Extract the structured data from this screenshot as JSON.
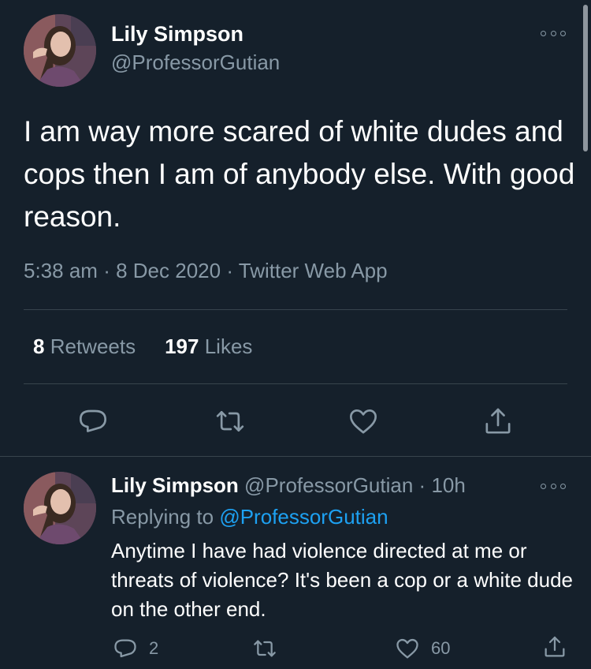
{
  "tweet": {
    "author_name": "Lily Simpson",
    "author_handle": "@ProfessorGutian",
    "text": "I am way more scared of white dudes and cops then I am of anybody else. With good reason.",
    "time": "5:38 am",
    "date": "8 Dec 2020",
    "source": "Twitter Web App",
    "retweets_count": "8",
    "retweets_label": "Retweets",
    "likes_count": "197",
    "likes_label": "Likes"
  },
  "reply": {
    "author_name": "Lily Simpson",
    "author_handle": "@ProfessorGutian",
    "age": "10h",
    "replying_to_label": "Replying to",
    "replying_to_handle": "@ProfessorGutian",
    "text": "Anytime I have had violence directed at me or threats of violence? It's been a cop or a white dude on the other end.",
    "reply_count": "2",
    "like_count": "60"
  },
  "separator": "·",
  "icons": [
    "more-icon",
    "reply-icon",
    "retweet-icon",
    "like-icon",
    "share-icon"
  ],
  "colors": {
    "background": "#15202b",
    "muted": "#8899a6",
    "link": "#1da1f2",
    "divider": "#38444d"
  }
}
